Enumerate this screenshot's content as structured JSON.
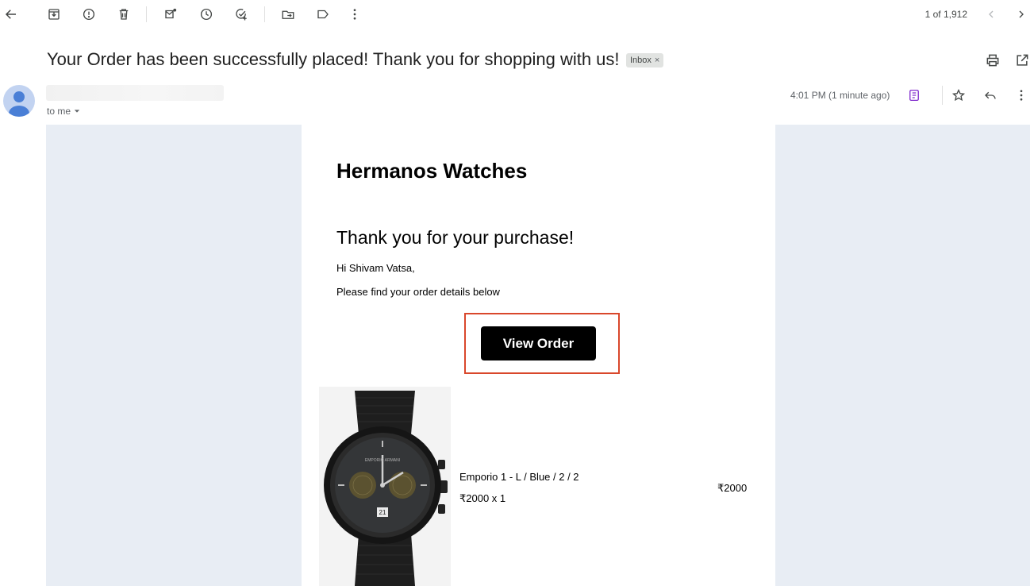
{
  "toolbar": {
    "icons": [
      "back-arrow-icon",
      "archive-icon",
      "report-spam-icon",
      "delete-icon",
      "mark-unread-icon",
      "snooze-icon",
      "add-task-icon",
      "move-to-icon",
      "label-icon",
      "more-options-icon"
    ],
    "pager_text": "1 of 1,912"
  },
  "email": {
    "subject": "Your Order has been successfully placed! Thank you for shopping with us!",
    "label_chip": "Inbox",
    "label_chip_close": "×",
    "recipient_text": "to me",
    "timestamp": "4:01 PM (1 minute ago)"
  },
  "content": {
    "brand": "Hermanos Watches",
    "heading": "Thank you for your purchase!",
    "greeting": "Hi Shivam Vatsa,",
    "intro": "Please find your order details below",
    "button_label": "View Order",
    "product": {
      "name": "Emporio 1 - L / Blue / 2 / 2",
      "price_qty": "₹2000 x 1",
      "line_total": "₹2000"
    }
  },
  "colors": {
    "email_background": "#e8edf4",
    "button": "#000000",
    "highlight": "#d9472b",
    "notes_icon": "#8430ce"
  }
}
